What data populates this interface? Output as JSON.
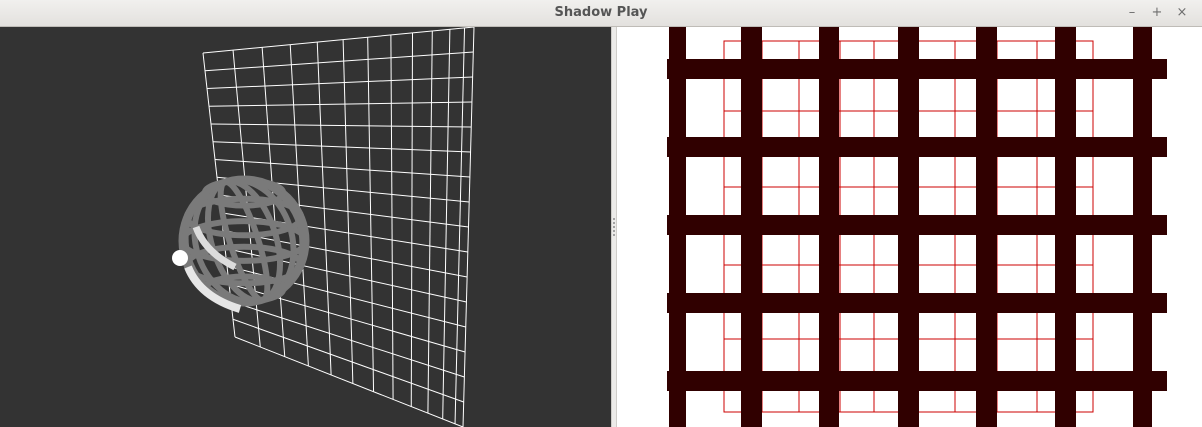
{
  "window": {
    "title": "Shadow Play",
    "minimize_label": "–",
    "maximize_label": "+",
    "close_label": "×"
  },
  "viewport_3d": {
    "background": "#333333",
    "grid_color": "#ffffff",
    "sphere_color": "#7a7a7a",
    "light_color": "#ffffff"
  },
  "shadow_view": {
    "background": "#ffffff",
    "shadow_color": "#300000",
    "grid_color": "#cc0000"
  }
}
